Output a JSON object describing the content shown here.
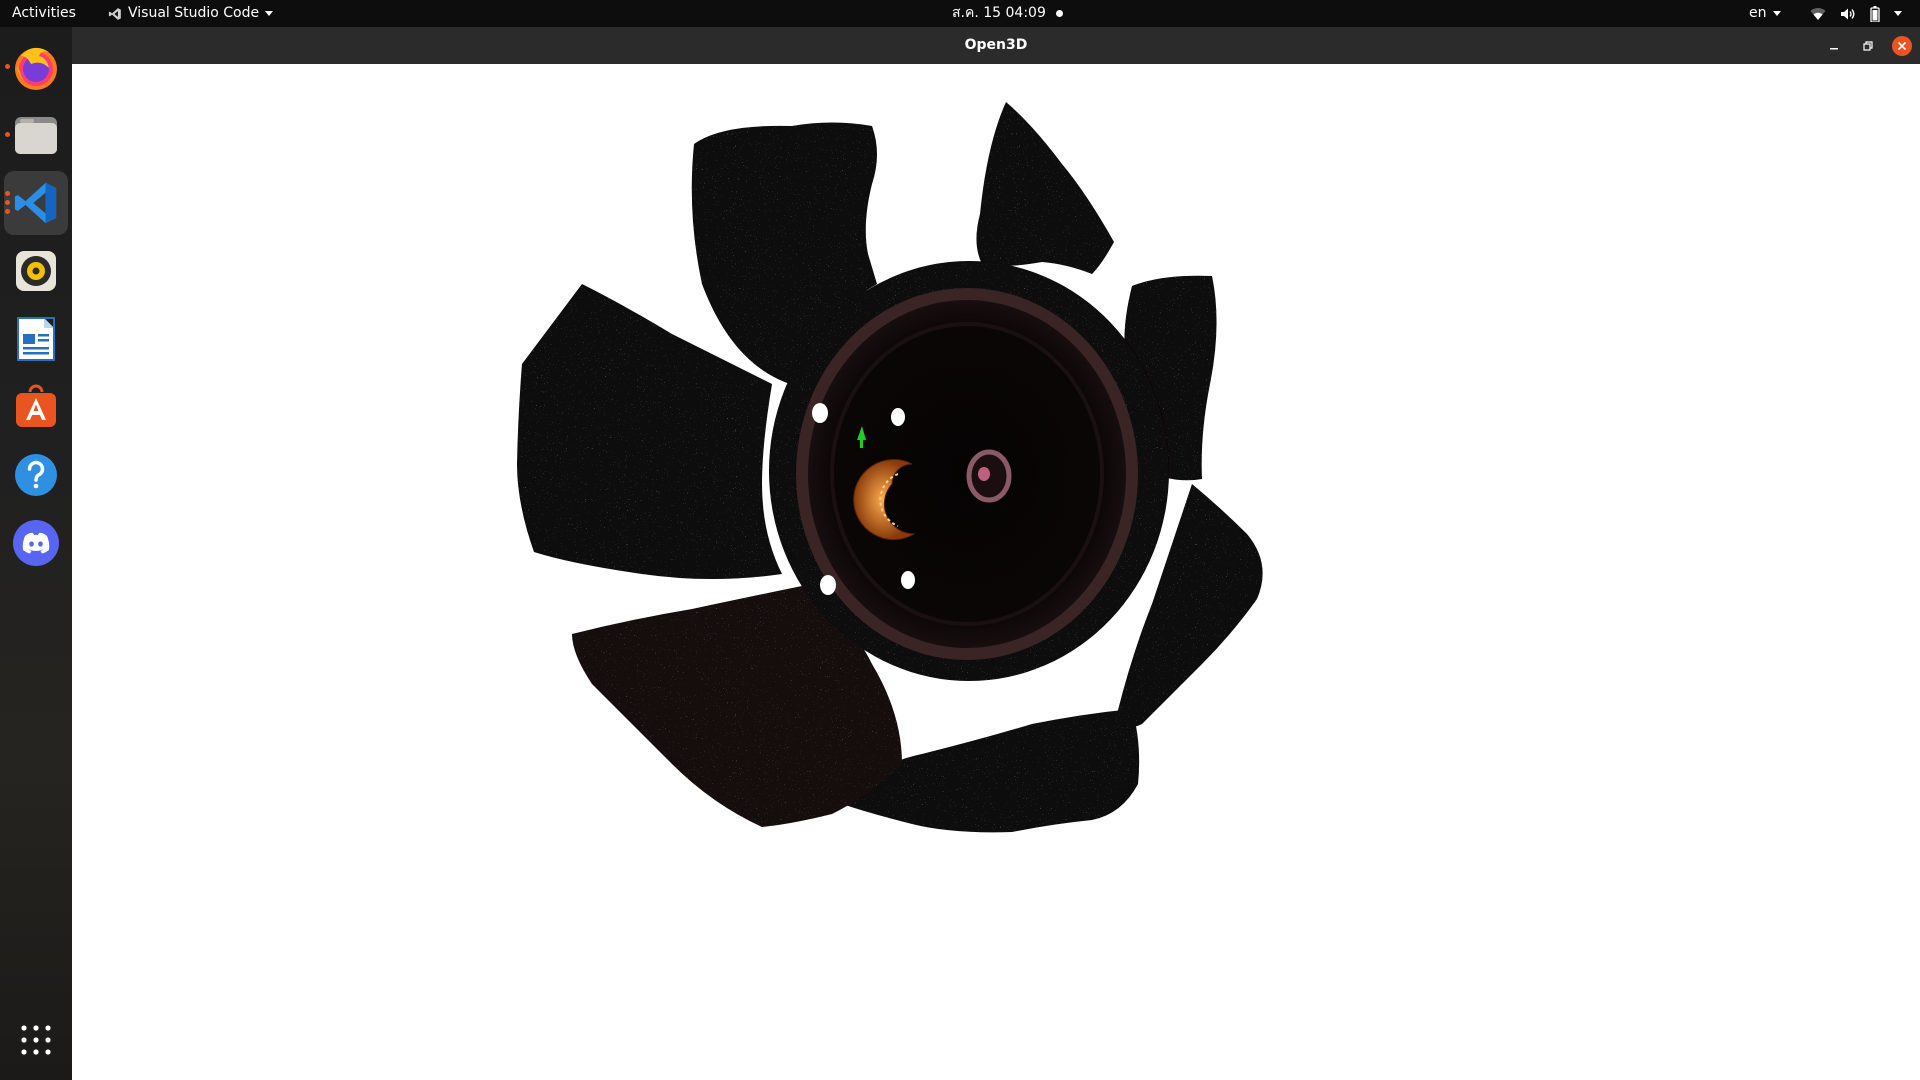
{
  "topbar": {
    "activities": "Activities",
    "app_name": "Visual Studio Code",
    "datetime": "ส.ค. 15  04:09",
    "language": "en"
  },
  "window": {
    "title": "Open3D"
  },
  "dock": {
    "items": [
      {
        "icon": "firefox-icon",
        "running": true
      },
      {
        "icon": "files-icon",
        "running": true
      },
      {
        "icon": "vscode-icon",
        "running": true,
        "active": true
      },
      {
        "icon": "rhythmbox-icon",
        "running": false
      },
      {
        "icon": "libreoffice-writer-icon",
        "running": false
      },
      {
        "icon": "software-center-icon",
        "running": false
      },
      {
        "icon": "help-icon",
        "running": false
      },
      {
        "icon": "discord-icon",
        "running": false
      },
      {
        "icon": "show-apps-icon",
        "running": false
      }
    ]
  },
  "colors": {
    "accent": "#e95420",
    "viewport_bg": "#ffffff",
    "fan": "#0c0808",
    "hub_ring": "#3a2424",
    "axis_green": "#22cc22",
    "axis_orange": "#d0721e"
  }
}
